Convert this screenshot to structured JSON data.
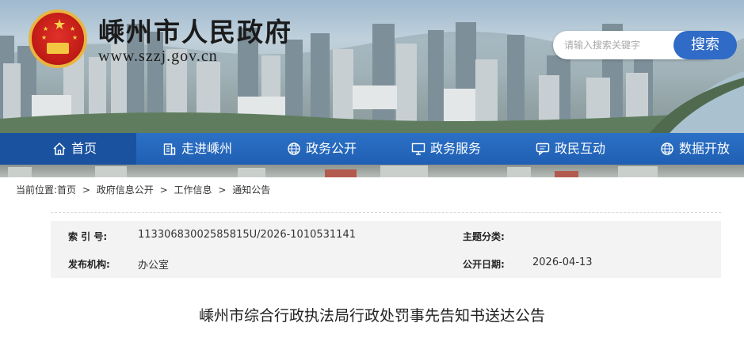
{
  "header": {
    "site_title": "嵊州市人民政府",
    "site_url": "www.szzj.gov.cn",
    "search_placeholder": "请输入搜索关键字",
    "search_button": "搜索"
  },
  "nav": {
    "items": [
      {
        "label": "首页",
        "icon": "home-icon"
      },
      {
        "label": "走进嵊州",
        "icon": "building-icon"
      },
      {
        "label": "政务公开",
        "icon": "globe-icon"
      },
      {
        "label": "政务服务",
        "icon": "monitor-icon"
      },
      {
        "label": "政民互动",
        "icon": "chat-icon"
      },
      {
        "label": "数据开放",
        "icon": "globe-icon"
      }
    ]
  },
  "breadcrumb": {
    "prefix": "当前位置:",
    "items": [
      "首页",
      "政府信息公开",
      "工作信息",
      "通知公告"
    ],
    "separator": ">"
  },
  "info": {
    "index_label": "索 引 号:",
    "index_value": "11330683002585815U/2026-1010531141",
    "topic_label": "主题分类:",
    "topic_value": "",
    "publisher_label": "发布机构:",
    "publisher_value": "办公室",
    "date_label": "公开日期:",
    "date_value": "2026-04-13"
  },
  "article": {
    "title": "嵊州市综合行政执法局行政处罚事先告知书送达公告"
  },
  "colors": {
    "nav_bg": "#2c71c6",
    "nav_active": "#1a52a0",
    "search_button": "#2f6bc7",
    "emblem_red": "#c41d17",
    "emblem_gold": "#e8b640"
  }
}
